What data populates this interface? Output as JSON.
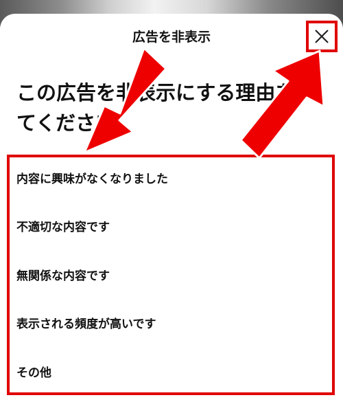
{
  "sheet": {
    "title": "広告を非表示",
    "question": "この広告を非表示にする理由をお聞かせください",
    "question_line1": "この広告を非表",
    "question_obscured": "示",
    "question_tail": "にする理由を",
    "question_line2": "てください",
    "close_icon": "close-x-icon"
  },
  "reasons": [
    {
      "label": "内容に興味がなくなりました"
    },
    {
      "label": "不適切な内容です"
    },
    {
      "label": "無関係な内容です"
    },
    {
      "label": "表示される頻度が高いです"
    },
    {
      "label": "その他"
    }
  ],
  "colors": {
    "highlight_red": "#e00000",
    "text": "#111111",
    "background": "#ffffff"
  }
}
